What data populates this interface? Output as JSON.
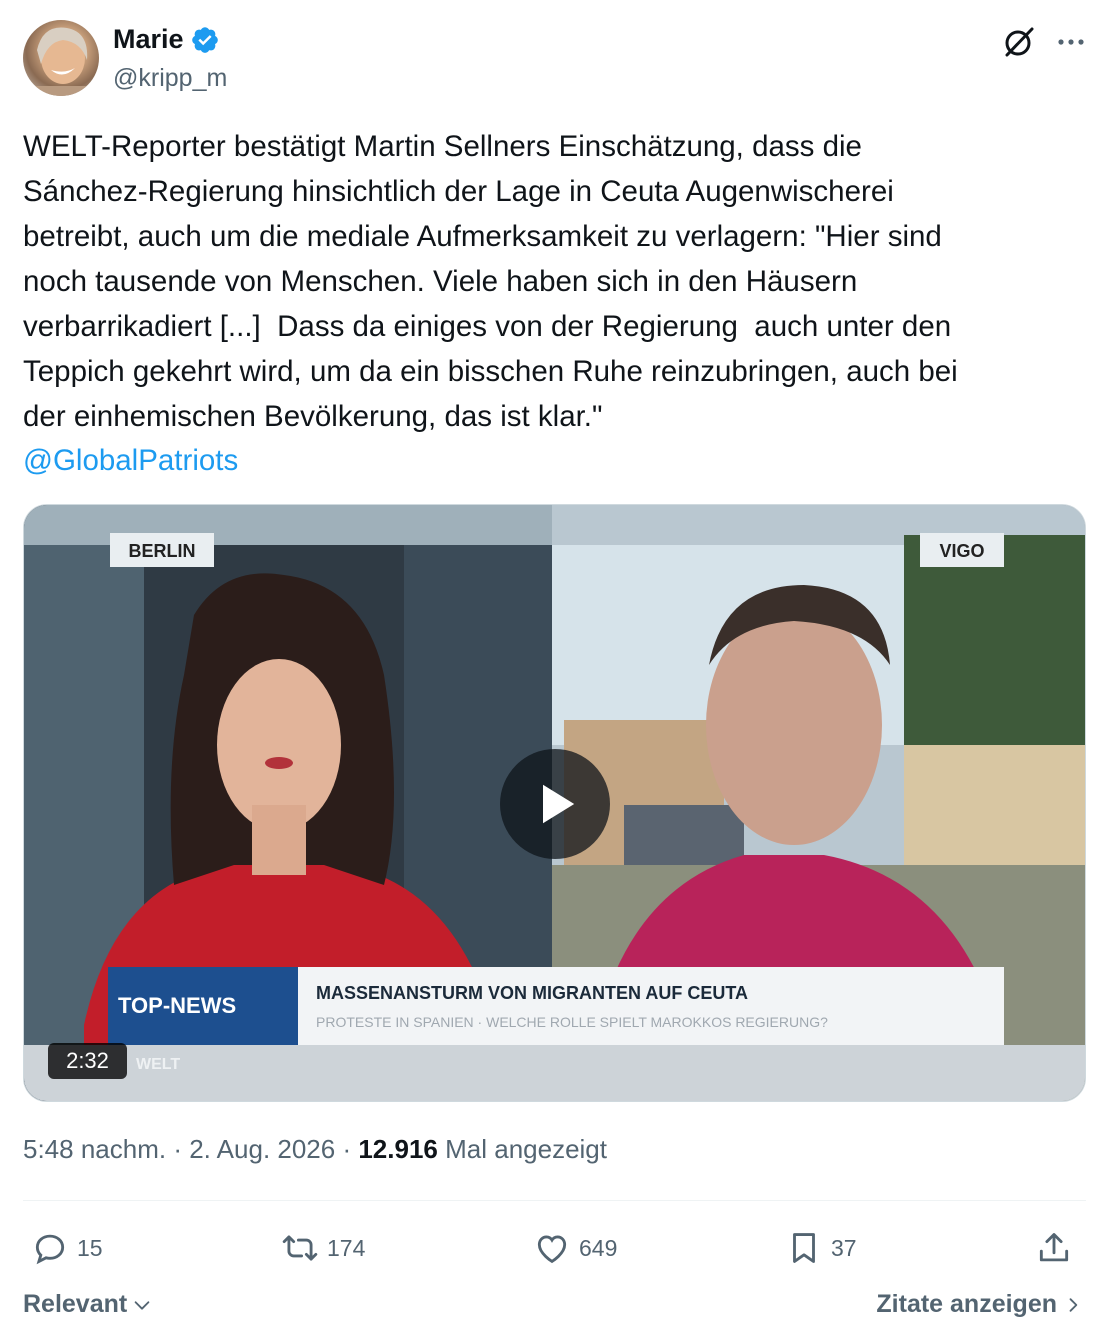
{
  "author": {
    "name": "Marie",
    "handle": "@kripp_m",
    "verified": true
  },
  "tweet": {
    "text": "WELT-Reporter bestätigt Martin Sellners Einschätzung, dass die\nSánchez-Regierung hinsichtlich der Lage in Ceuta Augenwischerei\nbetreibt, auch um die mediale Aufmerksamkeit zu verlagern: \"Hier sind\nnoch tausende von Menschen. Viele haben sich in den Häusern\nverbarrikadiert [...]  Dass da einiges von der Regierung  auch unter den\nTeppich gekehrt wird, um da ein bisschen Ruhe reinzubringen, auch bei\nder einhemischen Bevölkerung, das ist klar.\"",
    "mention": "@GlobalPatriots"
  },
  "video": {
    "duration": "2:32",
    "left_location": "BERLIN",
    "right_location": "VIGO",
    "lower_third_tag": "TOP-NEWS",
    "headline": "MASSENANSTURM VON MIGRANTEN AUF CEUTA",
    "subline": "PROTESTE IN SPANIEN · WELCHE ROLLE SPIELT MAROKKOS REGIERUNG?",
    "brand": "WELT"
  },
  "meta": {
    "time": "5:48 nachm.",
    "sep1": " · ",
    "date": "2. Aug. 2026",
    "sep2": " · ",
    "views": "12.916",
    "views_label": "Mal angezeigt"
  },
  "actions": {
    "replies": "15",
    "reposts": "174",
    "likes": "649",
    "bookmarks": "37"
  },
  "footer": {
    "sort_label": "Relevant",
    "quotes_label": "Zitate anzeigen"
  },
  "colors": {
    "link": "#1d9bf0",
    "muted": "#536471",
    "text": "#0f1419"
  }
}
